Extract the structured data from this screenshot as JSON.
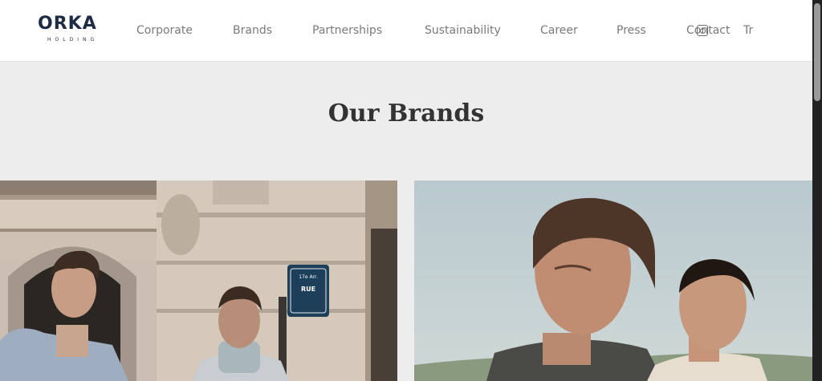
{
  "logo": {
    "name": "ORKA",
    "subtitle": "HOLDING"
  },
  "nav": {
    "items": [
      {
        "label": "Corporate"
      },
      {
        "label": "Brands"
      },
      {
        "label": "Partnerships"
      },
      {
        "label": "Sustainability"
      },
      {
        "label": "Career"
      },
      {
        "label": "Press"
      },
      {
        "label": "Contact"
      },
      {
        "label": "Tr"
      }
    ]
  },
  "main": {
    "title": "Our Brands",
    "street_sign": {
      "line1": "17e Arr.",
      "line2": "RUE"
    }
  },
  "colors": {
    "header_bg": "#ffffff",
    "page_bg": "#ededed",
    "logo": "#1e2b45",
    "nav_text": "#7a7a7a",
    "title": "#333333"
  },
  "icons": [
    "instagram-icon"
  ]
}
